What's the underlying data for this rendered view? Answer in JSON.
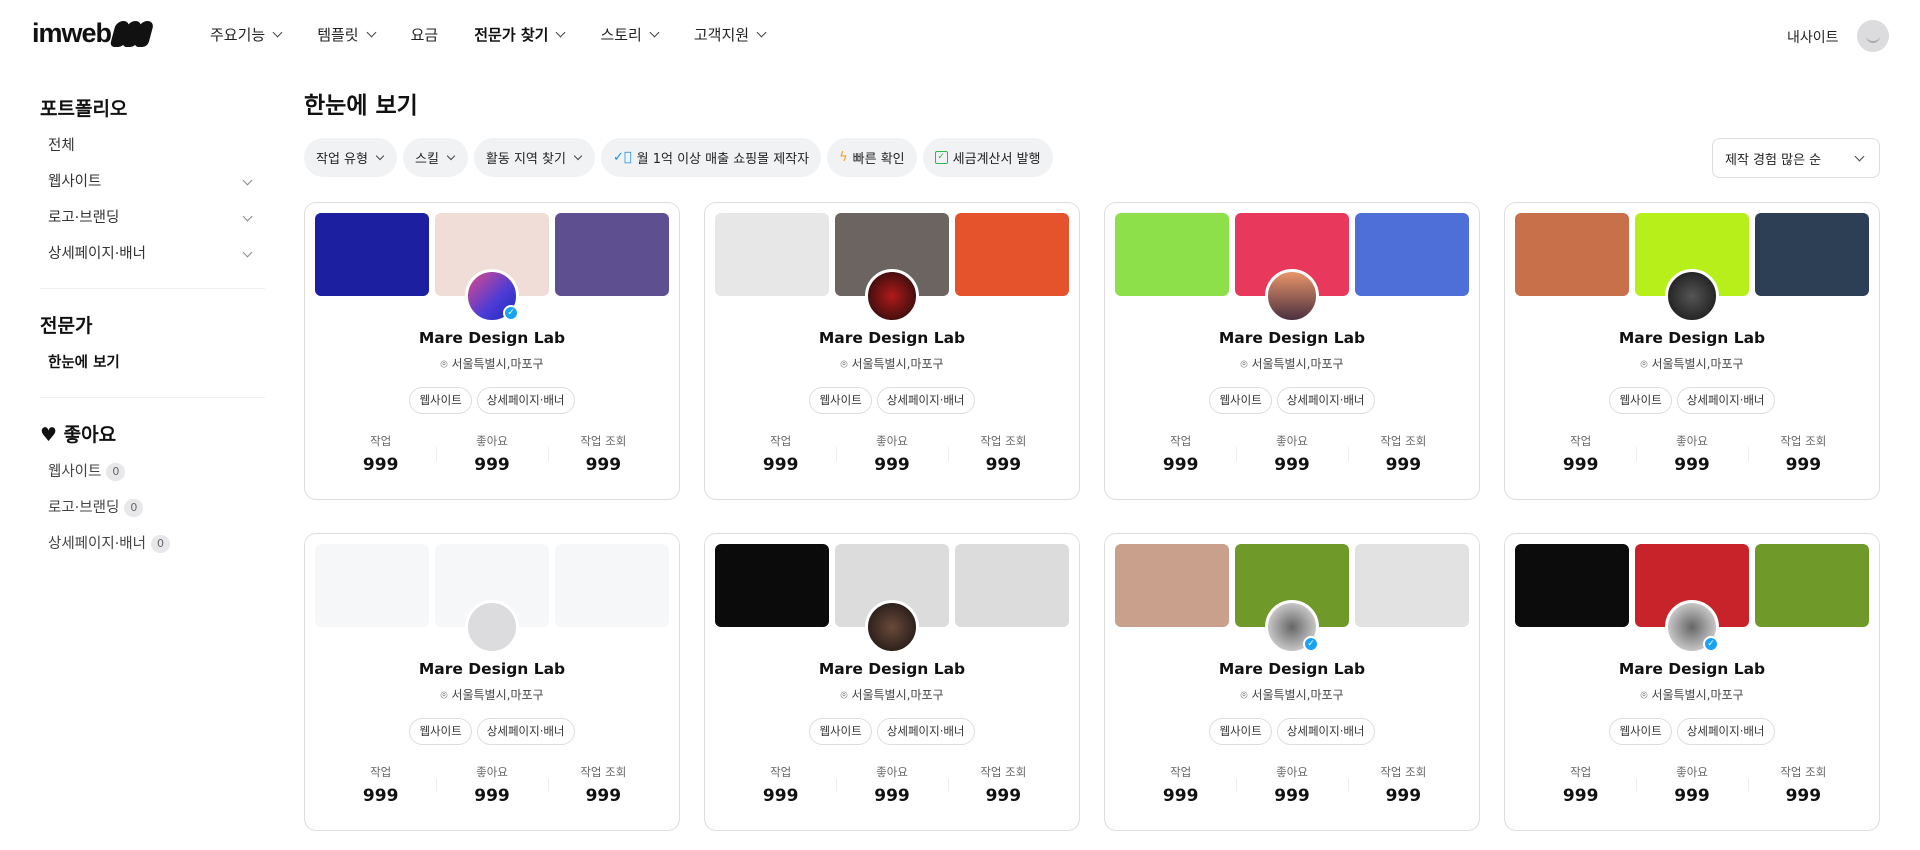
{
  "header": {
    "logo": "imweb",
    "nav": [
      {
        "label": "주요기능",
        "chev": true
      },
      {
        "label": "템플릿",
        "chev": true
      },
      {
        "label": "요금",
        "chev": false
      },
      {
        "label": "전문가 찾기",
        "chev": true,
        "bold": true
      },
      {
        "label": "스토리",
        "chev": true
      },
      {
        "label": "고객지원",
        "chev": true
      }
    ],
    "my_site": "내사이트"
  },
  "sidebar": {
    "portfolio_heading": "포트폴리오",
    "portfolio_items": [
      "전체",
      "웹사이트",
      "로고·브랜딩",
      "상세페이지·배너"
    ],
    "expert_heading": "전문가",
    "expert_items": [
      "한눈에 보기"
    ],
    "likes_heading": "좋아요",
    "likes_items": [
      {
        "label": "웹사이트",
        "count": "0"
      },
      {
        "label": "로고·브랜딩",
        "count": "0"
      },
      {
        "label": "상세페이지·배너",
        "count": "0"
      }
    ]
  },
  "main": {
    "title": "한눈에 보기",
    "filters": [
      "작업 유형",
      "스킬",
      "활동 지역 찾기"
    ],
    "badges": [
      "월 1억 이상 매출 쇼핑몰 제작자",
      "빠른 확인",
      "세금계산서 발행"
    ],
    "sort": "제작 경험 많은 순"
  },
  "card_labels": {
    "works": "작업",
    "likes": "좋아요",
    "views": "작업 조회"
  },
  "cards": [
    {
      "name": "Mare Design Lab",
      "location": "서울특별시,마포구",
      "tags": [
        "웹사이트",
        "상세페이지·배너"
      ],
      "works": "999",
      "likes": "999",
      "views": "999",
      "verified": true,
      "avatar": "linear-gradient(135deg,#e04a8a,#4a3bd6 60%,#1d2ab5)",
      "thumbs": [
        "#1c1fa0",
        "#f1ddd8",
        "#5e4f91"
      ]
    },
    {
      "name": "Mare Design Lab",
      "location": "서울특별시,마포구",
      "tags": [
        "웹사이트",
        "상세페이지·배너"
      ],
      "works": "999",
      "likes": "999",
      "views": "999",
      "verified": false,
      "avatar": "radial-gradient(circle,#b01a1a,#1a0a0a)",
      "thumbs": [
        "#e7e7e7",
        "#6c6460",
        "#e4532b"
      ]
    },
    {
      "name": "Mare Design Lab",
      "location": "서울특별시,마포구",
      "tags": [
        "웹사이트",
        "상세페이지·배너"
      ],
      "works": "999",
      "likes": "999",
      "views": "999",
      "verified": false,
      "avatar": "linear-gradient(180deg,#e9956a,#4a3040)",
      "thumbs": [
        "#8de04a",
        "#e8385c",
        "#4f6fd8"
      ]
    },
    {
      "name": "Mare Design Lab",
      "location": "서울특별시,마포구",
      "tags": [
        "웹사이트",
        "상세페이지·배너"
      ],
      "works": "999",
      "likes": "999",
      "views": "999",
      "verified": false,
      "avatar": "radial-gradient(circle,#555,#111)",
      "thumbs": [
        "#c8704a",
        "#b7ef1a",
        "#2d3f55"
      ]
    },
    {
      "name": "Mare Design Lab",
      "location": "서울특별시,마포구",
      "tags": [
        "웹사이트",
        "상세페이지·배너"
      ],
      "works": "999",
      "likes": "999",
      "views": "999",
      "verified": false,
      "avatar": "#dcdcdf",
      "thumbs": [
        "#f6f7f8",
        "#f6f7f8",
        "#f6f7f8"
      ]
    },
    {
      "name": "Mare Design Lab",
      "location": "서울특별시,마포구",
      "tags": [
        "웹사이트",
        "상세페이지·배너"
      ],
      "works": "999",
      "likes": "999",
      "views": "999",
      "verified": false,
      "avatar": "radial-gradient(circle,#6a4a3a,#151010)",
      "thumbs": [
        "#0b0b0b",
        "#dcdcdc",
        "#dcdcdc"
      ]
    },
    {
      "name": "Mare Design Lab",
      "location": "서울특별시,마포구",
      "tags": [
        "웹사이트",
        "상세페이지·배너"
      ],
      "works": "999",
      "likes": "999",
      "views": "999",
      "verified": true,
      "avatar": "radial-gradient(circle,#666,#eee)",
      "thumbs": [
        "#c9a08c",
        "#6f9a2a",
        "#e2e2e2"
      ]
    },
    {
      "name": "Mare Design Lab",
      "location": "서울특별시,마포구",
      "tags": [
        "웹사이트",
        "상세페이지·배너"
      ],
      "works": "999",
      "likes": "999",
      "views": "999",
      "verified": true,
      "avatar": "radial-gradient(circle,#666,#eee)",
      "thumbs": [
        "#0c0c0c",
        "#c8232a",
        "#6f9a2a"
      ]
    }
  ]
}
